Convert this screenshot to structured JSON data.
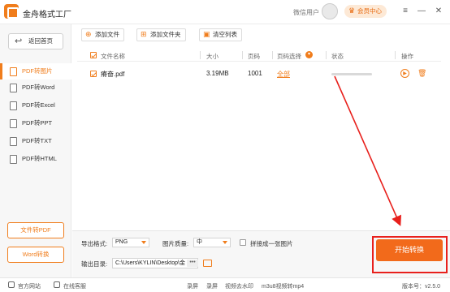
{
  "app": {
    "title": "金舟格式工厂"
  },
  "header": {
    "user_name": "微信用户",
    "vip_label": "会员中心",
    "window_controls": [
      "≡",
      "—",
      "✕"
    ]
  },
  "sidebar": {
    "back_label": "返回首页",
    "items": [
      {
        "label": "PDF转图片",
        "active": true
      },
      {
        "label": "PDF转Word",
        "active": false
      },
      {
        "label": "PDF转Excel",
        "active": false
      },
      {
        "label": "PDF转PPT",
        "active": false
      },
      {
        "label": "PDF转TXT",
        "active": false
      },
      {
        "label": "PDF转HTML",
        "active": false
      }
    ],
    "bottom_buttons": [
      "文件转PDF",
      "Word转换"
    ]
  },
  "toolbar": {
    "add_file": "添加文件",
    "add_folder": "添加文件夹",
    "clear_list": "清空列表"
  },
  "table": {
    "headers": {
      "name": "文件名称",
      "size": "大小",
      "pages": "页码",
      "page_select": "页码选择",
      "status": "状态",
      "actions": "操作"
    },
    "rows": [
      {
        "name": "瘠奋.pdf",
        "size": "3.19MB",
        "pages": "1001",
        "page_select": "全部",
        "checked": true,
        "progress": 0
      }
    ]
  },
  "settings": {
    "format_label": "导出格式:",
    "format_value": "PNG",
    "quality_label": "图片质量:",
    "quality_value": "中",
    "merge_label": "拼接成一张图片",
    "output_label": "输出目录:",
    "output_path": "C:\\Users\\KYLIN\\Desktop\\金",
    "browse_label": "•••",
    "start_label": "开始转换"
  },
  "statusbar": {
    "website": "官方网站",
    "service": "在线客服",
    "tools": [
      "录屏",
      "录屏",
      "视频去水印",
      "m3u8视频转mp4"
    ],
    "version": "版本号：v2.5.0"
  },
  "colors": {
    "accent": "#f07d1c",
    "start_button": "#f26a1b",
    "annotation": "#e8201c"
  },
  "icons": {
    "logo": "app-logo-icon",
    "back": "return-icon",
    "add_file": "plus-icon",
    "add_folder": "folder-plus-icon",
    "clear": "trash-icon",
    "play": "play-icon",
    "delete": "trash-icon",
    "folder": "folder-icon"
  }
}
